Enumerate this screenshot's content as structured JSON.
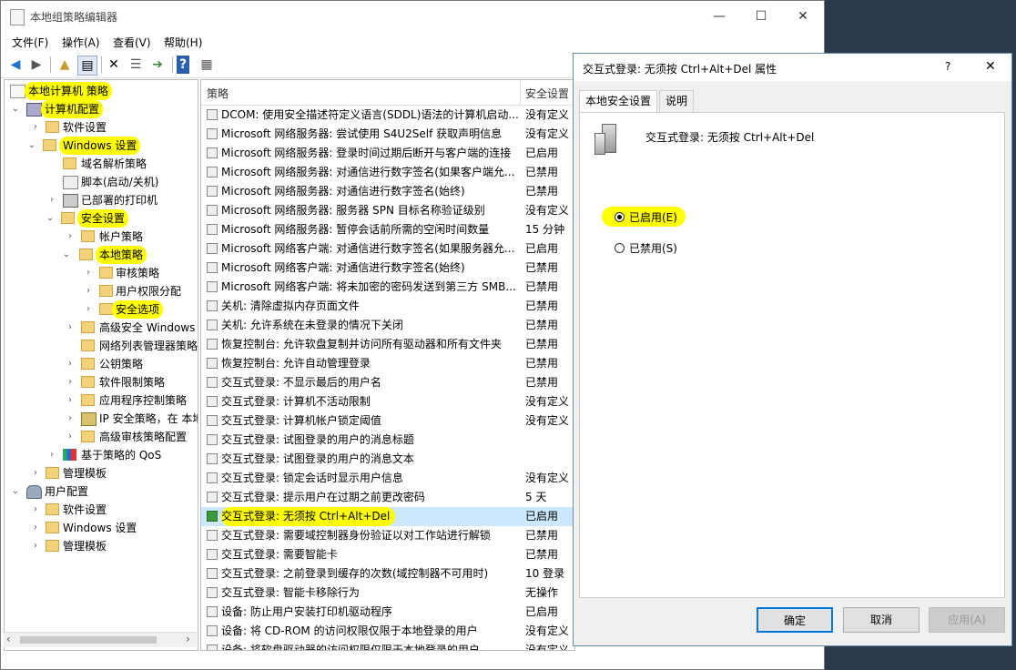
{
  "window": {
    "title": "本地组策略编辑器",
    "controls": {
      "minimize": "—",
      "maximize": "☐",
      "close": "✕"
    }
  },
  "menu": {
    "file": "文件(F)",
    "action": "操作(A)",
    "view": "查看(V)",
    "help": "帮助(H)"
  },
  "toolbar": {
    "icons": [
      "back-icon",
      "forward-icon",
      "up-folder-icon",
      "show-tree-icon",
      "delete-icon",
      "properties-icon",
      "export-icon",
      "help-icon",
      "view-icon"
    ]
  },
  "tree": {
    "items": [
      {
        "label": "本地计算机 策略",
        "highlighted": true
      },
      {
        "label": "计算机配置",
        "highlighted": true
      },
      {
        "label": "软件设置"
      },
      {
        "label": "Windows 设置",
        "highlighted": true
      },
      {
        "label": "域名解析策略"
      },
      {
        "label": "脚本(启动/关机)"
      },
      {
        "label": "已部署的打印机"
      },
      {
        "label": "安全设置",
        "highlighted": true
      },
      {
        "label": "帐户策略"
      },
      {
        "label": "本地策略",
        "highlighted": true
      },
      {
        "label": "审核策略"
      },
      {
        "label": "用户权限分配"
      },
      {
        "label": "安全选项",
        "highlighted": true
      },
      {
        "label": "高级安全 Windows"
      },
      {
        "label": "网络列表管理器策略"
      },
      {
        "label": "公钥策略"
      },
      {
        "label": "软件限制策略"
      },
      {
        "label": "应用程序控制策略"
      },
      {
        "label": "IP 安全策略，在 本地"
      },
      {
        "label": "高级审核策略配置"
      },
      {
        "label": "基于策略的 QoS"
      },
      {
        "label": "管理模板"
      },
      {
        "label": "用户配置"
      },
      {
        "label": "软件设置"
      },
      {
        "label": "Windows 设置"
      },
      {
        "label": "管理模板"
      }
    ]
  },
  "list": {
    "col_policy": "策略",
    "col_setting": "安全设置",
    "rows": [
      {
        "name": "DCOM: 使用安全描述符定义语言(SDDL)语法的计算机启动...",
        "value": "没有定义"
      },
      {
        "name": "Microsoft 网络服务器: 尝试使用 S4U2Self 获取声明信息",
        "value": "没有定义"
      },
      {
        "name": "Microsoft 网络服务器: 登录时间过期后断开与客户端的连接",
        "value": "已启用"
      },
      {
        "name": "Microsoft 网络服务器: 对通信进行数字签名(如果客户端允...",
        "value": "已禁用"
      },
      {
        "name": "Microsoft 网络服务器: 对通信进行数字签名(始终)",
        "value": "已禁用"
      },
      {
        "name": "Microsoft 网络服务器: 服务器 SPN 目标名称验证级别",
        "value": "没有定义"
      },
      {
        "name": "Microsoft 网络服务器: 暂停会话前所需的空闲时间数量",
        "value": "15 分钟"
      },
      {
        "name": "Microsoft 网络客户端: 对通信进行数字签名(如果服务器允...",
        "value": "已启用"
      },
      {
        "name": "Microsoft 网络客户端: 对通信进行数字签名(始终)",
        "value": "已禁用"
      },
      {
        "name": "Microsoft 网络客户端: 将未加密的密码发送到第三方 SMB...",
        "value": "已禁用"
      },
      {
        "name": "关机: 清除虚拟内存页面文件",
        "value": "已禁用"
      },
      {
        "name": "关机: 允许系统在未登录的情况下关闭",
        "value": "已禁用"
      },
      {
        "name": "恢复控制台: 允许软盘复制并访问所有驱动器和所有文件夹",
        "value": "已禁用"
      },
      {
        "name": "恢复控制台: 允许自动管理登录",
        "value": "已禁用"
      },
      {
        "name": "交互式登录: 不显示最后的用户名",
        "value": "已禁用"
      },
      {
        "name": "交互式登录: 计算机不活动限制",
        "value": "没有定义"
      },
      {
        "name": "交互式登录: 计算机帐户锁定阈值",
        "value": "没有定义"
      },
      {
        "name": "交互式登录: 试图登录的用户的消息标题",
        "value": ""
      },
      {
        "name": "交互式登录: 试图登录的用户的消息文本",
        "value": ""
      },
      {
        "name": "交互式登录: 锁定会话时显示用户信息",
        "value": "没有定义"
      },
      {
        "name": "交互式登录: 提示用户在过期之前更改密码",
        "value": "5 天"
      },
      {
        "name": "交互式登录: 无须按 Ctrl+Alt+Del",
        "value": "已启用",
        "selected": true
      },
      {
        "name": "交互式登录: 需要域控制器身份验证以对工作站进行解锁",
        "value": "已禁用"
      },
      {
        "name": "交互式登录: 需要智能卡",
        "value": "已禁用"
      },
      {
        "name": "交互式登录: 之前登录到缓存的次数(域控制器不可用时)",
        "value": "10 登录"
      },
      {
        "name": "交互式登录: 智能卡移除行为",
        "value": "无操作"
      },
      {
        "name": "设备: 防止用户安装打印机驱动程序",
        "value": "已启用"
      },
      {
        "name": "设备: 将 CD-ROM 的访问权限仅限于本地登录的用户",
        "value": "没有定义"
      },
      {
        "name": "设备: 将软盘驱动器的访问权限仅限于本地登录的用户",
        "value": "没有定义"
      }
    ]
  },
  "dialog": {
    "title": "交互式登录: 无须按 Ctrl+Alt+Del 属性",
    "help_btn": "?",
    "close_btn": "✕",
    "tab_local": "本地安全设置",
    "tab_explain": "说明",
    "policy_name": "交互式登录: 无须按 Ctrl+Alt+Del",
    "enabled_label": "已启用(E)",
    "disabled_label": "已禁用(S)",
    "selected": "enabled",
    "ok": "确定",
    "cancel": "取消",
    "apply": "应用(A)"
  },
  "colors": {
    "highlight": "#ffff00",
    "selection": "#cce8ff",
    "accent": "#0078d7"
  }
}
